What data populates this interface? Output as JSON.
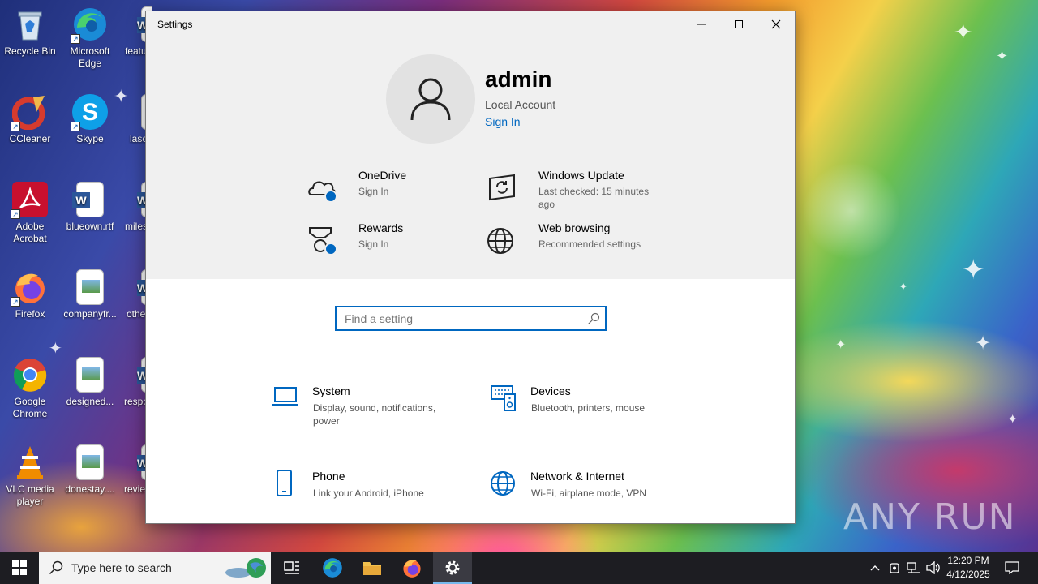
{
  "desktop": {
    "icons": [
      {
        "label": "Recycle Bin",
        "icon": "recycle-bin-icon"
      },
      {
        "label": "Microsoft Edge",
        "icon": "edge-icon"
      },
      {
        "label": "featu",
        "icon": "document-icon"
      },
      {
        "label": "CCleaner",
        "icon": "ccleaner-icon"
      },
      {
        "label": "Skype",
        "icon": "skype-icon"
      },
      {
        "label": "lasc",
        "icon": "document-icon"
      },
      {
        "label": "Adobe Acrobat",
        "icon": "acrobat-icon"
      },
      {
        "label": "blueown.rtf",
        "icon": "word-doc-icon"
      },
      {
        "label": "miles",
        "icon": "word-doc-icon"
      },
      {
        "label": "Firefox",
        "icon": "firefox-icon"
      },
      {
        "label": "companyfr...",
        "icon": "image-file-icon"
      },
      {
        "label": "othe",
        "icon": "word-doc-icon"
      },
      {
        "label": "Google Chrome",
        "icon": "chrome-icon"
      },
      {
        "label": "designed...",
        "icon": "image-file-icon"
      },
      {
        "label": "respo",
        "icon": "word-doc-icon"
      },
      {
        "label": "VLC media player",
        "icon": "vlc-icon"
      },
      {
        "label": "donestay....",
        "icon": "image-file-icon"
      },
      {
        "label": "revie",
        "icon": "word-doc-icon"
      }
    ],
    "watermark": "ANY RUN"
  },
  "window": {
    "title": "Settings",
    "user": {
      "name": "admin",
      "account_type": "Local Account",
      "sign_in": "Sign In"
    },
    "status_items": [
      {
        "title": "OneDrive",
        "subtitle": "Sign In",
        "icon": "onedrive-icon"
      },
      {
        "title": "Windows Update",
        "subtitle": "Last checked: 15 minutes ago",
        "icon": "windows-update-icon"
      },
      {
        "title": "Rewards",
        "subtitle": "Sign In",
        "icon": "rewards-icon"
      },
      {
        "title": "Web browsing",
        "subtitle": "Recommended settings",
        "icon": "globe-icon"
      }
    ],
    "search": {
      "placeholder": "Find a setting"
    },
    "categories": [
      {
        "title": "System",
        "subtitle": "Display, sound, notifications, power",
        "icon": "laptop-icon"
      },
      {
        "title": "Devices",
        "subtitle": "Bluetooth, printers, mouse",
        "icon": "devices-icon"
      },
      {
        "title": "Phone",
        "subtitle": "Link your Android, iPhone",
        "icon": "phone-icon"
      },
      {
        "title": "Network & Internet",
        "subtitle": "Wi-Fi, airplane mode, VPN",
        "icon": "globe-icon"
      }
    ],
    "accent_color": "#0067c0"
  },
  "taskbar": {
    "search_placeholder": "Type here to search",
    "time": "12:20 PM",
    "date": "4/12/2025"
  }
}
